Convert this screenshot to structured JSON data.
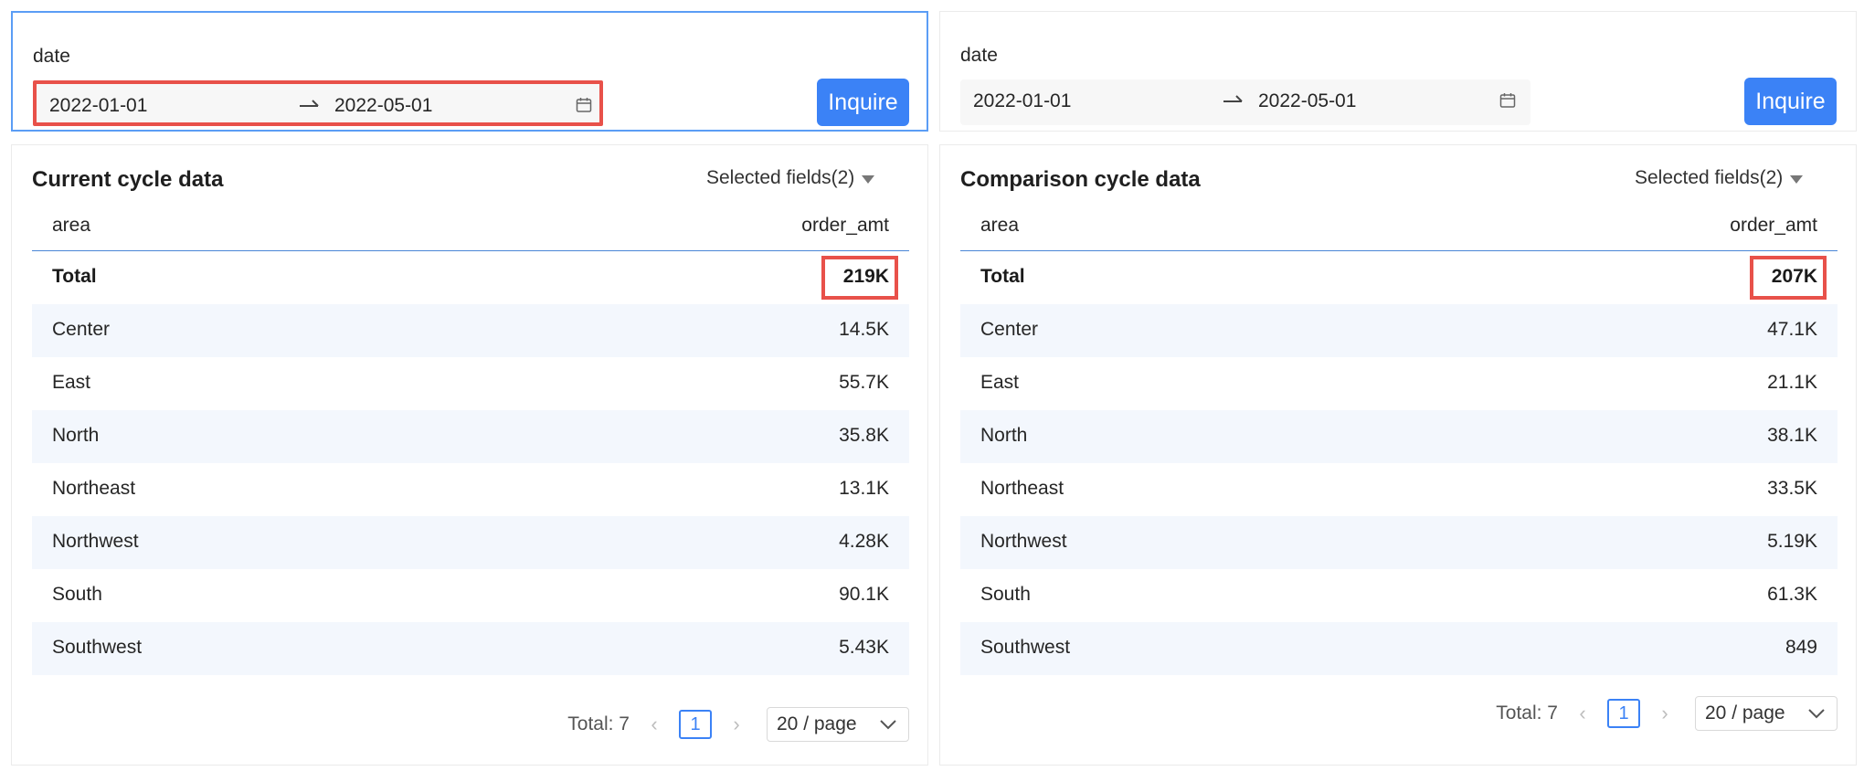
{
  "panels": [
    {
      "filter": {
        "label": "date",
        "start": "2022-01-01",
        "end": "2022-05-01"
      },
      "inquire_label": "Inquire",
      "title": "Current cycle data",
      "fields_label": "Selected fields(2)",
      "columns": {
        "area": "area",
        "amt": "order_amt"
      },
      "total": {
        "area": "Total",
        "amt": "219K"
      },
      "rows": [
        {
          "area": "Center",
          "amt": "14.5K"
        },
        {
          "area": "East",
          "amt": "55.7K"
        },
        {
          "area": "North",
          "amt": "35.8K"
        },
        {
          "area": "Northeast",
          "amt": "13.1K"
        },
        {
          "area": "Northwest",
          "amt": "4.28K"
        },
        {
          "area": "South",
          "amt": "90.1K"
        },
        {
          "area": "Southwest",
          "amt": "5.43K"
        }
      ],
      "pager": {
        "total_text": "Total: 7",
        "page": "1",
        "page_size": "20 / page"
      }
    },
    {
      "filter": {
        "label": "date",
        "start": "2022-01-01",
        "end": "2022-05-01"
      },
      "inquire_label": "Inquire",
      "title": "Comparison cycle data",
      "fields_label": "Selected fields(2)",
      "columns": {
        "area": "area",
        "amt": "order_amt"
      },
      "total": {
        "area": "Total",
        "amt": "207K"
      },
      "rows": [
        {
          "area": "Center",
          "amt": "47.1K"
        },
        {
          "area": "East",
          "amt": "21.1K"
        },
        {
          "area": "North",
          "amt": "38.1K"
        },
        {
          "area": "Northeast",
          "amt": "33.5K"
        },
        {
          "area": "Northwest",
          "amt": "5.19K"
        },
        {
          "area": "South",
          "amt": "61.3K"
        },
        {
          "area": "Southwest",
          "amt": "849"
        }
      ],
      "pager": {
        "total_text": "Total: 7",
        "page": "1",
        "page_size": "20 / page"
      }
    }
  ],
  "colors": {
    "accent": "#3b82f6",
    "highlight": "#e8514a",
    "stripe": "#f3f7fd"
  },
  "icons": {
    "range_separator": "arrow-right-icon",
    "calendar": "calendar-icon",
    "dropdown": "caret-down-icon",
    "prev": "chevron-left-icon",
    "next": "chevron-right-icon",
    "size": "chevron-down-icon"
  }
}
